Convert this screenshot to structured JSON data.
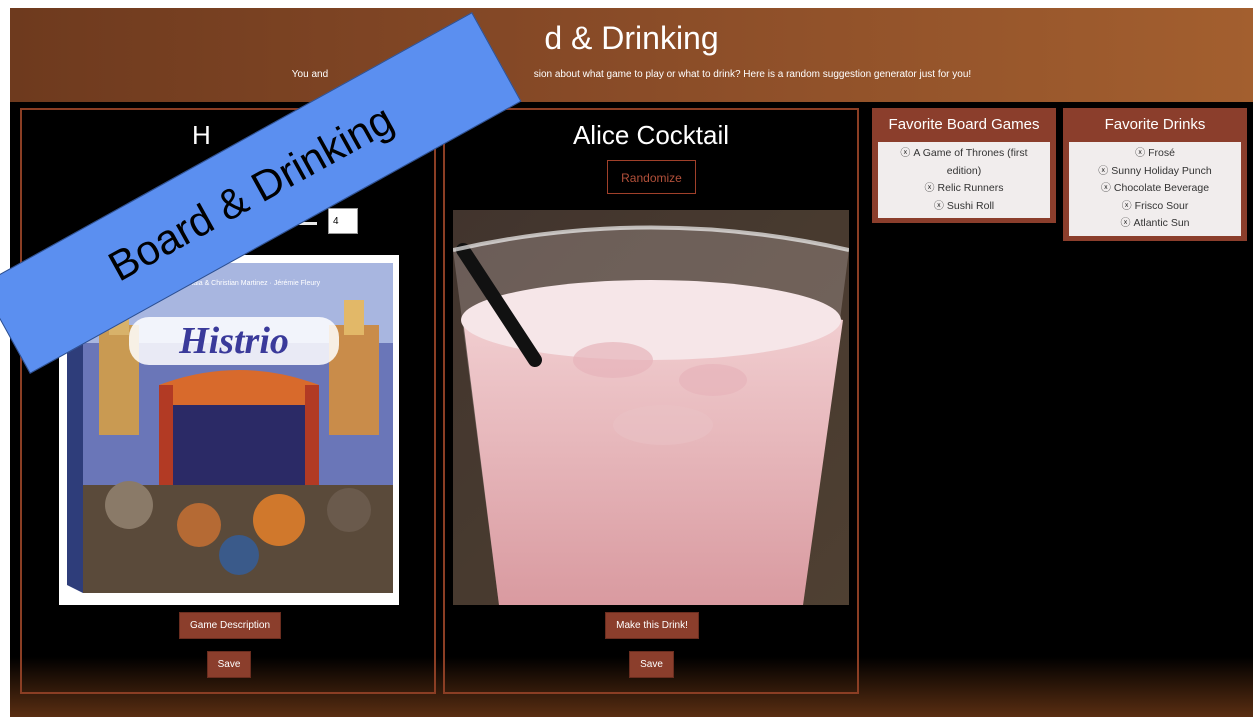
{
  "header": {
    "title": "Board & Drinking",
    "visible_title": "d & Drinking",
    "subtitle": "You and your friends can't come to a decision about what game to play or what to drink? Here is a random suggestion generator just for you!",
    "visible_subtitle": "You and                                                                          sion about what game to play or what to drink? Here is a random suggestion generator just for you!"
  },
  "banner": {
    "text": "Board & Drinking"
  },
  "game_panel": {
    "title_visible": "H",
    "player_count": "4",
    "image_text": "Histrio",
    "credits": "Bruno Cathala & Christian Martinez · Jérémie Fleury",
    "description_button": "Game Description",
    "save_button": "Save"
  },
  "drink_panel": {
    "title": "Alice Cocktail",
    "randomize_button": "Randomize",
    "make_button": "Make this Drink!",
    "save_button": "Save"
  },
  "favorite_games": {
    "title": "Favorite Board Games",
    "remove_icon": "ⓧ",
    "items": [
      "A Game of Thrones (first edition)",
      "Relic Runners",
      "Sushi Roll"
    ]
  },
  "favorite_drinks": {
    "title": "Favorite Drinks",
    "remove_icon": "ⓧ",
    "items": [
      "Frosé",
      "Sunny Holiday Punch",
      "Chocolate Beverage",
      "Frisco Sour",
      "Atlantic Sun"
    ]
  },
  "colors": {
    "header_gradient_start": "#6e3a1e",
    "header_gradient_end": "#a35f2f",
    "accent": "#8b3e2c",
    "banner": "#5b8ff0"
  }
}
